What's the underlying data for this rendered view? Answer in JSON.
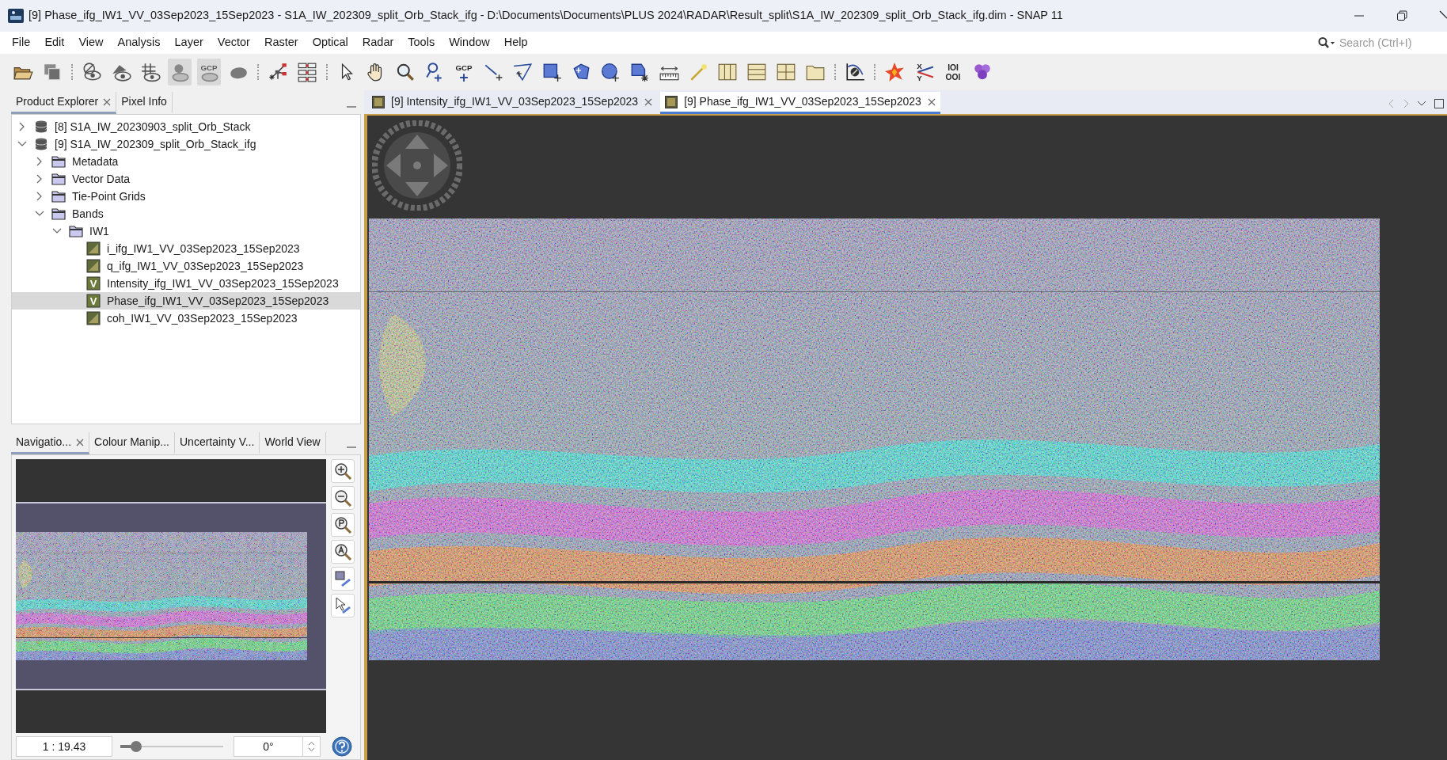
{
  "window": {
    "title": "[9] Phase_ifg_IW1_VV_03Sep2023_15Sep2023 - S1A_IW_202309_split_Orb_Stack_ifg - D:\\Documents\\Documents\\PLUS 2024\\RADAR\\Result_split\\S1A_IW_202309_split_Orb_Stack_ifg.dim - SNAP 11"
  },
  "menu": [
    "File",
    "Edit",
    "View",
    "Analysis",
    "Layer",
    "Vector",
    "Raster",
    "Optical",
    "Radar",
    "Tools",
    "Window",
    "Help"
  ],
  "search": {
    "placeholder": "Search (Ctrl+I)"
  },
  "toolbar": [
    [
      {
        "kind": "open",
        "disabled": false
      },
      {
        "kind": "save",
        "disabled": false
      }
    ],
    [
      {
        "kind": "hide-eye",
        "disabled": false
      },
      {
        "kind": "layers-eye",
        "disabled": false
      },
      {
        "kind": "grid-eye",
        "disabled": false
      },
      {
        "kind": "pin-eye",
        "disabled": true
      },
      {
        "kind": "gcp-eye",
        "labels": [
          "GCP"
        ],
        "disabled": true
      },
      {
        "kind": "blob",
        "disabled": false
      }
    ],
    [
      {
        "kind": "graph",
        "disabled": false
      },
      {
        "kind": "graph-grid",
        "disabled": false
      }
    ],
    [
      {
        "kind": "pointer",
        "disabled": false
      },
      {
        "kind": "hand",
        "disabled": false
      },
      {
        "kind": "zoom",
        "disabled": false
      },
      {
        "kind": "pin-plus",
        "disabled": false
      },
      {
        "kind": "gcp-plus",
        "labels": [
          "GCP"
        ],
        "disabled": false
      },
      {
        "kind": "line",
        "disabled": false
      },
      {
        "kind": "polyline",
        "disabled": false
      },
      {
        "kind": "rect",
        "disabled": false
      },
      {
        "kind": "polygon",
        "disabled": false
      },
      {
        "kind": "ellipse",
        "disabled": false
      },
      {
        "kind": "select-shape",
        "disabled": false
      },
      {
        "kind": "ruler",
        "disabled": false
      },
      {
        "kind": "wand",
        "disabled": false
      },
      {
        "kind": "cols",
        "disabled": false
      },
      {
        "kind": "rows",
        "disabled": false
      },
      {
        "kind": "tiles",
        "disabled": false
      },
      {
        "kind": "folder",
        "disabled": false
      }
    ],
    [
      {
        "kind": "profile",
        "disabled": false
      }
    ],
    [
      {
        "kind": "star",
        "disabled": false
      },
      {
        "kind": "xy",
        "labels": [
          "X",
          "Y"
        ],
        "disabled": false
      },
      {
        "kind": "binary",
        "labels": [
          "IOI",
          "OOI"
        ],
        "disabled": false
      },
      {
        "kind": "hexes",
        "disabled": false
      }
    ]
  ],
  "explorer_tabs": [
    {
      "label": "Product Explorer",
      "closable": true,
      "selected": true
    },
    {
      "label": "Pixel Info",
      "closable": false,
      "selected": false
    }
  ],
  "tree": [
    {
      "label": "[8] S1A_IW_20230903_split_Orb_Stack",
      "kind": "product",
      "expanded": false,
      "selected": false
    },
    {
      "label": "[9] S1A_IW_202309_split_Orb_Stack_ifg",
      "kind": "product",
      "expanded": true,
      "selected": false,
      "children": [
        {
          "label": "Metadata",
          "kind": "folder",
          "expanded": false,
          "selected": false
        },
        {
          "label": "Vector Data",
          "kind": "folder",
          "expanded": false,
          "selected": false
        },
        {
          "label": "Tie-Point Grids",
          "kind": "folder",
          "expanded": false,
          "selected": false
        },
        {
          "label": "Bands",
          "kind": "folder",
          "expanded": true,
          "selected": false,
          "children": [
            {
              "label": "IW1",
              "kind": "folder",
              "expanded": true,
              "selected": false,
              "children": [
                {
                  "label": "i_ifg_IW1_VV_03Sep2023_15Sep2023",
                  "kind": "band",
                  "selected": false
                },
                {
                  "label": "q_ifg_IW1_VV_03Sep2023_15Sep2023",
                  "kind": "band",
                  "selected": false
                },
                {
                  "label": "Intensity_ifg_IW1_VV_03Sep2023_15Sep2023",
                  "kind": "virtual",
                  "icon_label": "V",
                  "selected": false
                },
                {
                  "label": "Phase_ifg_IW1_VV_03Sep2023_15Sep2023",
                  "kind": "virtual",
                  "icon_label": "V",
                  "selected": true
                },
                {
                  "label": "coh_IW1_VV_03Sep2023_15Sep2023",
                  "kind": "band",
                  "selected": false
                }
              ]
            }
          ]
        }
      ]
    }
  ],
  "tool_tabs": [
    {
      "label": "Navigatio...",
      "closable": true,
      "selected": true
    },
    {
      "label": "Colour Manip...",
      "closable": false,
      "selected": false
    },
    {
      "label": "Uncertainty V...",
      "closable": false,
      "selected": false
    },
    {
      "label": "World View",
      "closable": false,
      "selected": false
    }
  ],
  "navigation": {
    "zoom": "1 : 19.43",
    "slider": {
      "level": 0.15
    },
    "rotation": "0°"
  },
  "editor_tabs": [
    {
      "label": "[9] Intensity_ifg_IW1_VV_03Sep2023_15Sep2023",
      "closable": true,
      "selected": false
    },
    {
      "label": "[9] Phase_ifg_IW1_VV_03Sep2023_15Sep2023",
      "closable": true,
      "selected": true
    }
  ]
}
